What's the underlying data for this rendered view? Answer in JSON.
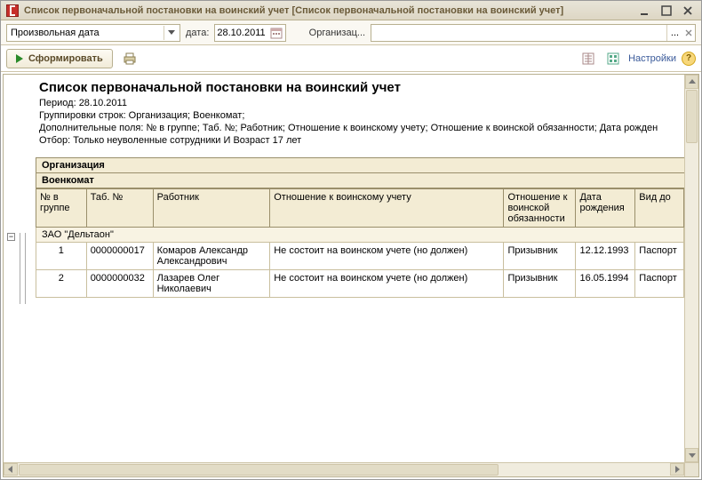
{
  "window": {
    "title": "Список первоначальной постановки на воинский учет [Список первоначальной постановки на воинский учет]"
  },
  "toolbar1": {
    "period_dropdown": "Произвольная дата",
    "date_label": "дата:",
    "date_value": "28.10.2011",
    "org_label": "Организац...",
    "org_value": "",
    "org_dots": "..."
  },
  "toolbar2": {
    "form_button": "Сформировать",
    "settings_link": "Настройки"
  },
  "report": {
    "title": "Список первоначальной постановки на воинский учет",
    "meta1": "Период: 28.10.2011",
    "meta2": "Группировки строк: Организация; Военкомат;",
    "meta3": "Дополнительные поля: № в группе; Таб. №; Работник; Отношение к воинскому учету; Отношение к воинской обязанности; Дата рожден",
    "meta4": "Отбор: Только неуволенные сотрудники И Возраст 17 лет",
    "band1": "Организация",
    "band2": "Военкомат",
    "columns": [
      "№ в группе",
      "Таб. №",
      "Работник",
      "Отношение к воинскому учету",
      "Отношение к воинской обязанности",
      "Дата рождения",
      "Вид до"
    ],
    "group_row": "ЗАО \"Дельтаон\"",
    "rows": [
      {
        "n": "1",
        "tab": "0000000017",
        "worker": "Комаров Александр Александрович",
        "rel1": "Не состоит на воинском учете (но должен)",
        "rel2": "Призывник",
        "dob": "12.12.1993",
        "doc": "Паспорт"
      },
      {
        "n": "2",
        "tab": "0000000032",
        "worker": "Лазарев Олег Николаевич",
        "rel1": "Не состоит на воинском учете (но должен)",
        "rel2": "Призывник",
        "dob": "16.05.1994",
        "doc": "Паспорт"
      }
    ]
  },
  "tree_toggle": "−"
}
